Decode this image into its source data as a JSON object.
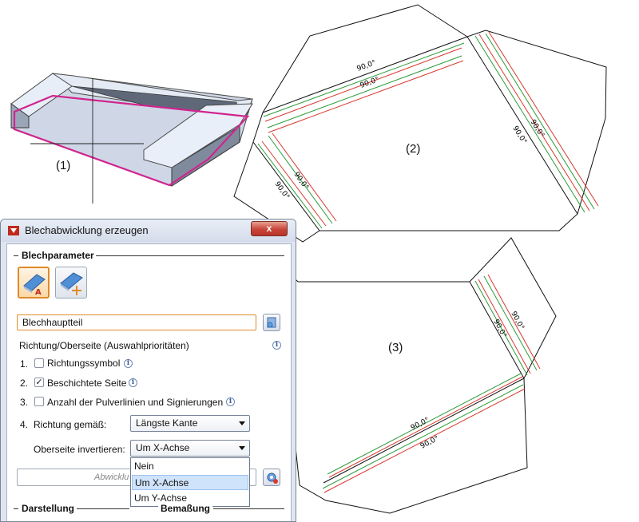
{
  "canvas": {
    "labels": {
      "part1": "(1)",
      "part2": "(2)",
      "part3": "(3)"
    },
    "angle_label": "90,0°",
    "colors": {
      "magenta": "#d0258f",
      "green": "#2a9d3a",
      "red": "#d83a30"
    }
  },
  "dialog": {
    "title": "Blechabwicklung erzeugen",
    "close_label": "x",
    "blechparameter": {
      "heading": "Blechparameter",
      "icon1": "sheet-main-part-icon",
      "icon2": "sheet-add-part-icon",
      "main_part_value": "Blechhauptteil",
      "priorities_label": "Richtung/Oberseite (Auswahlprioritäten)",
      "options": [
        {
          "num": "1.",
          "label": "Richtungssymbol",
          "checked": false
        },
        {
          "num": "2.",
          "label": "Beschichtete Seite",
          "checked": true
        },
        {
          "num": "3.",
          "label": "Anzahl der Pulverlinien und Signierungen",
          "checked": false
        }
      ],
      "direction": {
        "num": "4.",
        "label": "Richtung gemäß:",
        "value": "Längste Kante"
      },
      "invert": {
        "label": "Oberseite invertieren:",
        "value": "Um X-Achse"
      },
      "dropdown_options": [
        "Nein",
        "Um X-Achse",
        "Um Y-Achse"
      ],
      "dropdown_selected": "Um X-Achse",
      "text_field_partial": "Abwicklu"
    },
    "darstellung_heading": "Darstellung",
    "bemassung_heading": "Bemaßung",
    "info_glyph": "i",
    "check_glyph": "✓"
  }
}
